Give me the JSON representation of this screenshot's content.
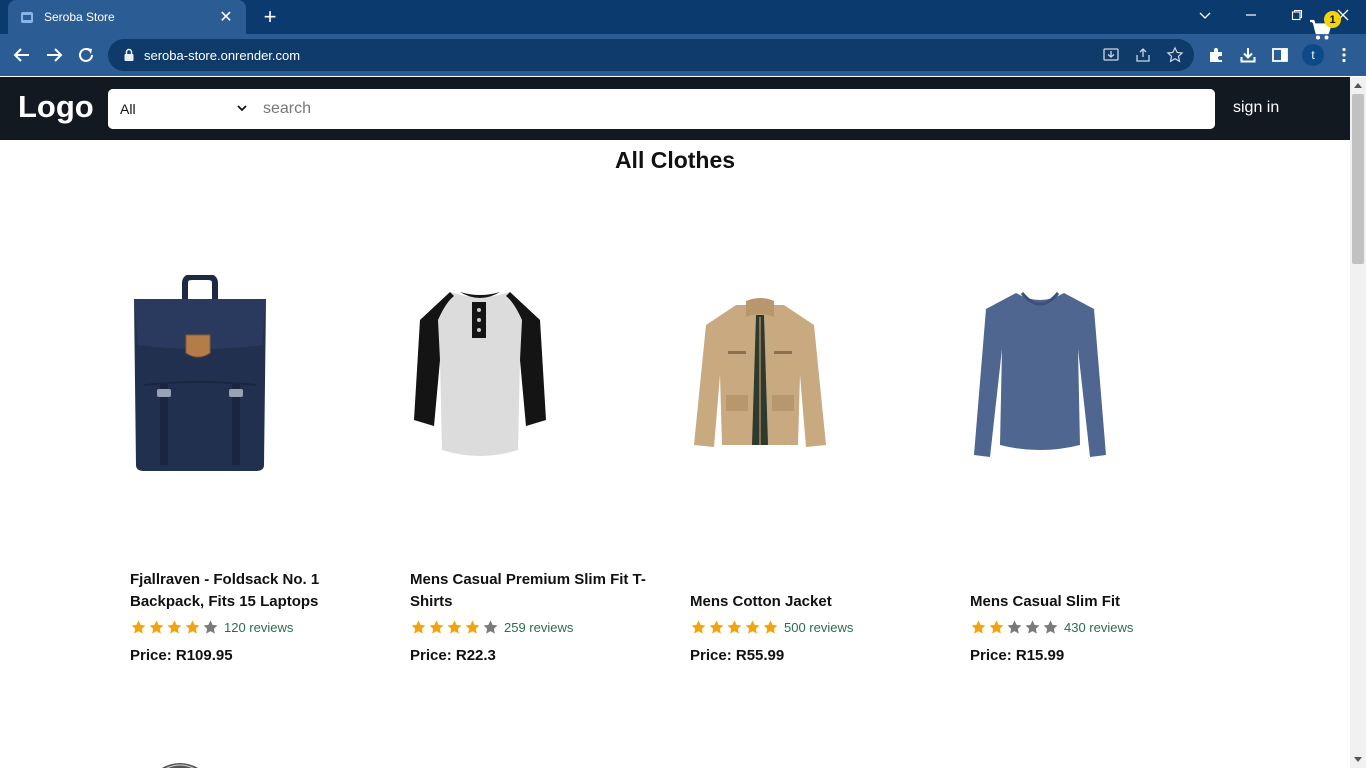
{
  "browser": {
    "tab_title": "Seroba Store",
    "url": "seroba-store.onrender.com",
    "profile_initial": "t"
  },
  "header": {
    "logo": "Logo",
    "category_selected": "All",
    "search_placeholder": "search",
    "signin_label": "sign in",
    "cart_count": "1"
  },
  "main": {
    "title": "All Clothes",
    "products": [
      {
        "name": "Fjallraven - Foldsack No. 1 Backpack, Fits 15 Laptops",
        "rating": 4,
        "reviews": "120 reviews",
        "price": "Price: R109.95",
        "icon": "backpack-image"
      },
      {
        "name": "Mens Casual Premium Slim Fit T-Shirts",
        "rating": 4,
        "reviews": "259 reviews",
        "price": "Price: R22.3",
        "icon": "raglan-shirt-image"
      },
      {
        "name": "Mens Cotton Jacket",
        "rating": 5,
        "reviews": "500 reviews",
        "price": "Price: R55.99",
        "icon": "jacket-image"
      },
      {
        "name": "Mens Casual Slim Fit",
        "rating": 2,
        "reviews": "430 reviews",
        "price": "Price: R15.99",
        "icon": "longsleeve-image"
      }
    ]
  },
  "colors": {
    "header_bg": "#131921",
    "star_filled": "#f5a30a",
    "star_empty": "#7a7a7a",
    "reviews_text": "#2c6e4a",
    "badge": "#f5d50a"
  }
}
